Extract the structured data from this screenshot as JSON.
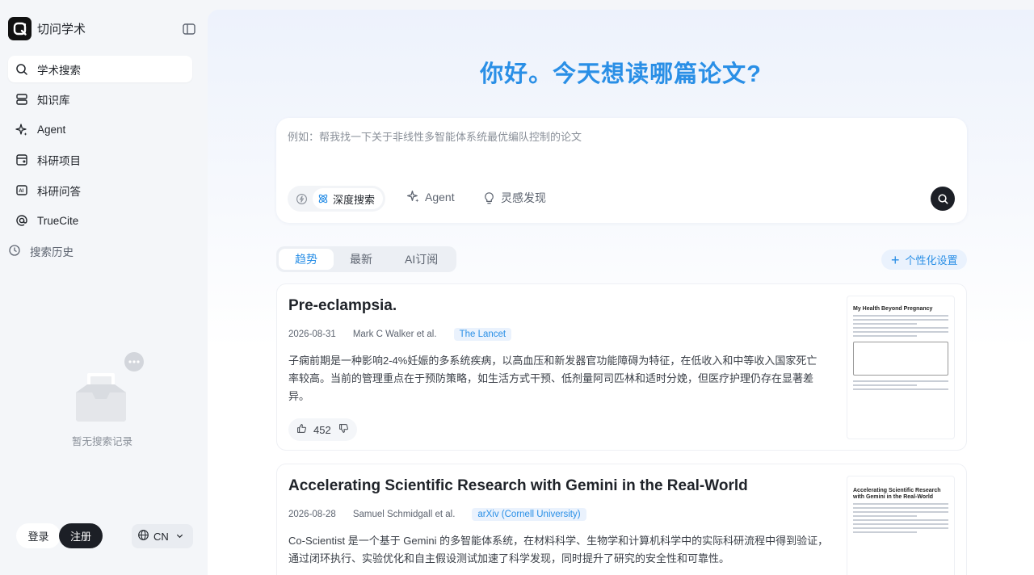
{
  "app": {
    "name": "切问学术"
  },
  "sidebar": {
    "items": [
      {
        "label": "学术搜索",
        "icon": "search-icon",
        "active": true
      },
      {
        "label": "知识库",
        "icon": "database-icon",
        "active": false
      },
      {
        "label": "Agent",
        "icon": "sparkle-icon",
        "active": false
      },
      {
        "label": "科研项目",
        "icon": "project-icon",
        "active": false
      },
      {
        "label": "科研问答",
        "icon": "ai-chat-icon",
        "active": false
      },
      {
        "label": "TrueCite",
        "icon": "at-icon",
        "active": false
      }
    ],
    "history_label": "搜索历史",
    "empty_label": "暂无搜索记录",
    "login_label": "登录",
    "signup_label": "注册",
    "language": "CN"
  },
  "hero": {
    "title": "你好。今天想读哪篇论文?"
  },
  "search": {
    "placeholder": "例如：帮我找一下关于非线性多智能体系统最优编队控制的论文",
    "value": "",
    "modes": {
      "deep": "深度搜索",
      "agent": "Agent",
      "inspiration": "灵感发现"
    }
  },
  "tabs": [
    {
      "label": "趋势",
      "active": true
    },
    {
      "label": "最新",
      "active": false
    },
    {
      "label": "AI订阅",
      "active": false
    }
  ],
  "personalize_label": "个性化设置",
  "papers": [
    {
      "title": "Pre-eclampsia.",
      "date": "2026-08-31",
      "authors": "Mark C Walker et al.",
      "venue": "The Lancet",
      "abstract": "子痫前期是一种影响2-4%妊娠的多系统疾病，以高血压和新发器官功能障碍为特征，在低收入和中等收入国家死亡率较高。当前的管理重点在于预防策略，如生活方式干预、低剂量阿司匹林和适时分娩，但医疗护理仍存在显著差异。",
      "likes": "452",
      "thumbnail_title": "My Health Beyond Pregnancy"
    },
    {
      "title": "Accelerating Scientific Research with Gemini in the Real-World",
      "date": "2026-08-28",
      "authors": "Samuel Schmidgall et al.",
      "venue": "arXiv (Cornell University)",
      "abstract": "Co-Scientist 是一个基于 Gemini 的多智能体系统，在材料科学、生物学和计算机科学中的实际科研流程中得到验证，通过闭环执行、实验优化和自主假设测试加速了科学发现，同时提升了研究的安全性和可靠性。",
      "thumbnail_title": "Accelerating Scientific Research with Gemini in the Real-World"
    }
  ],
  "colors": {
    "accent": "#2a8fe6",
    "dark_button": "#1c1f26",
    "sidebar_bg": "#f4f6f9"
  }
}
